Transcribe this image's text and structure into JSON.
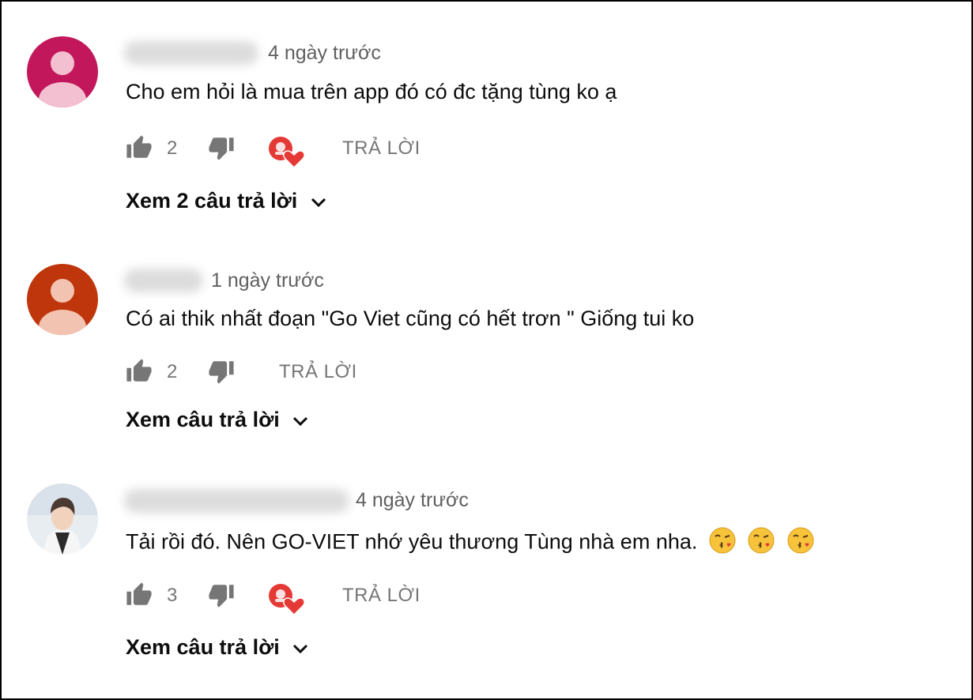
{
  "comments": [
    {
      "avatar_color": "#c2185b",
      "time": "4 ngày trước",
      "text": "Cho em hỏi là mua trên app đó có đc tặng tùng ko ạ",
      "likes": "2",
      "reply_label": "TRẢ LỜI",
      "view_replies": "Xem 2 câu trả lời",
      "creator_heart": true
    },
    {
      "avatar_color": "#bf360c",
      "time": "1 ngày trước",
      "text": "Có ai thik nhất đoạn \"Go Viet cũng có hết trơn \" Giống tui ko",
      "likes": "2",
      "reply_label": "TRẢ LỜI",
      "view_replies": "Xem câu trả lời",
      "creator_heart": false
    },
    {
      "avatar_color": "photo",
      "time": "4 ngày trước",
      "text": "Tải rồi đó. Nên GO-VIET nhớ yêu thương Tùng nhà em nha.",
      "emojis": [
        "kissing-face-icon",
        "kissing-face-icon",
        "kissing-face-icon"
      ],
      "likes": "3",
      "reply_label": "TRẢ LỜI",
      "view_replies": "Xem câu trả lời",
      "creator_heart": true
    }
  ],
  "icons": {
    "like": "thumbs-up-icon",
    "dislike": "thumbs-down-icon",
    "heart": "creator-heart-icon",
    "expand": "chevron-down-icon"
  },
  "colors": {
    "text": "#0d0d0d",
    "meta": "#606060",
    "action": "#767676",
    "heart": "#e53935"
  }
}
